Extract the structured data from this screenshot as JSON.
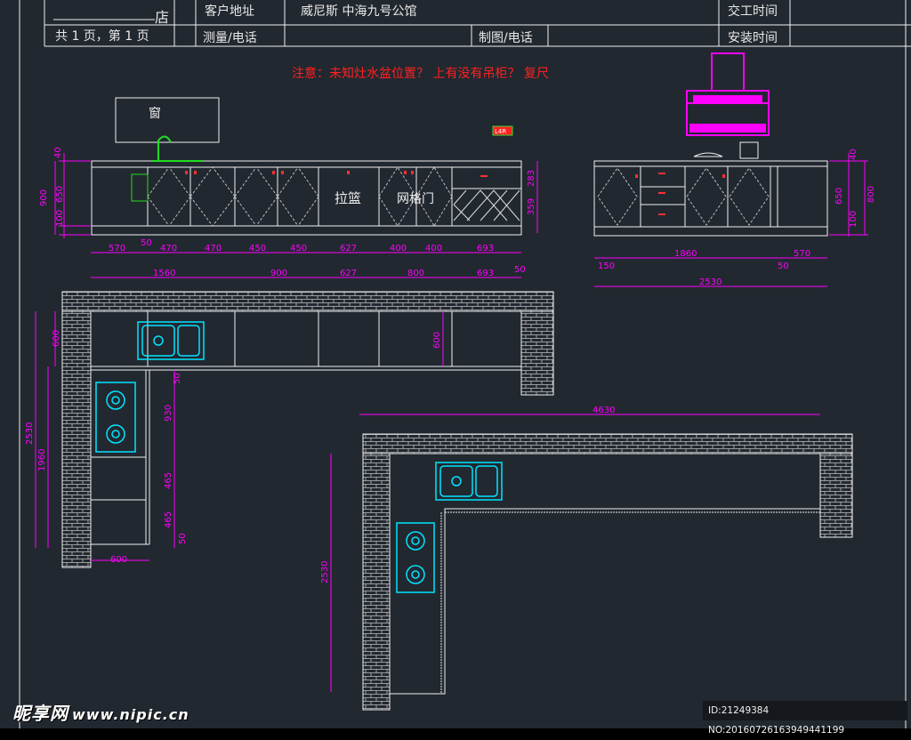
{
  "title_block": {
    "store_suffix": "店",
    "pages": "共 1 页，第 1 页",
    "customer_address_label": "客户地址",
    "customer_address_value": "威尼斯 中海九号公馆",
    "delivery_time_label": "交工时间",
    "measure_phone_label": "测量/电话",
    "drawing_phone_label": "制图/电话",
    "install_time_label": "安装时间"
  },
  "note": "注意：未知灶水盆位置？ 上有没有吊柜？ 复尺",
  "elevation_left": {
    "window_label": "窗",
    "basket_label": "拉篮",
    "grid_door_label": "网格门",
    "tag_label": "L4R",
    "vertical_dims": [
      "40",
      "900",
      "650",
      "100",
      "283",
      "359"
    ],
    "top_dims": [
      "570",
      "470",
      "470",
      "450",
      "450",
      "627",
      "400",
      "400",
      "693"
    ],
    "small_dims": [
      "50",
      "50"
    ],
    "bottom_dims": [
      "1560",
      "900",
      "627",
      "800",
      "693"
    ]
  },
  "elevation_right": {
    "vertical_dims": [
      "40",
      "650",
      "100",
      "800"
    ],
    "top_dims": [
      "1860",
      "570"
    ],
    "small_dims": [
      "150",
      "50"
    ],
    "total_dim": "2530"
  },
  "plan_left": {
    "dims": [
      "600",
      "2530",
      "1960",
      "600",
      "50",
      "930",
      "465",
      "465",
      "50",
      "600"
    ]
  },
  "plan_right": {
    "dims": [
      "4630",
      "2530"
    ]
  },
  "watermark": {
    "brand": "昵享网",
    "url": "www.nipic.cn",
    "id_text": "ID:21249384 NO:20160726163949441199"
  },
  "colors": {
    "background": "#222830",
    "line": "#f0f0f0",
    "dimension": "#ff00ff",
    "fixture": "#00e5ff",
    "note": "#ff2020",
    "faucet": "#22dd22"
  }
}
